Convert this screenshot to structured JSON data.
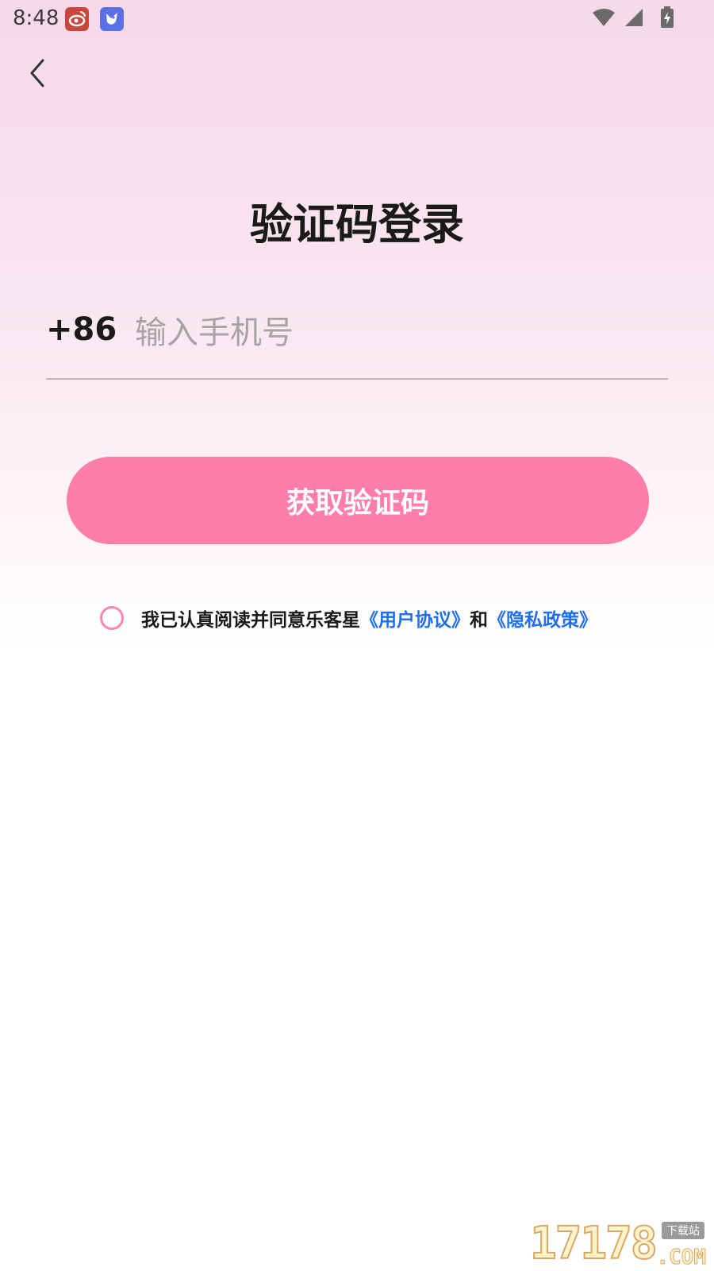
{
  "status_bar": {
    "time": "8:48",
    "icons": [
      "weibo-app-icon",
      "bird-app-icon",
      "wifi-icon",
      "signal-icon",
      "battery-charging-icon"
    ]
  },
  "header": {
    "back_icon": "chevron-left-icon"
  },
  "title": "验证码登录",
  "phone": {
    "country_code": "+86",
    "placeholder": "输入手机号",
    "value": ""
  },
  "get_code_button": "获取验证码",
  "agreement": {
    "checked": false,
    "prefix": "我已认真阅读并同意乐客星",
    "user_agreement": "《用户协议》",
    "conjunction": "和",
    "privacy_policy": "《隐私政策》"
  },
  "watermark": {
    "digits": "17178",
    "tag": "下载站",
    "suffix": ".COM"
  },
  "colors": {
    "accent": "#ff7dab",
    "link": "#1e6ff0",
    "checkbox_border": "#ff86ae",
    "background_top": "#f7d9e8"
  }
}
